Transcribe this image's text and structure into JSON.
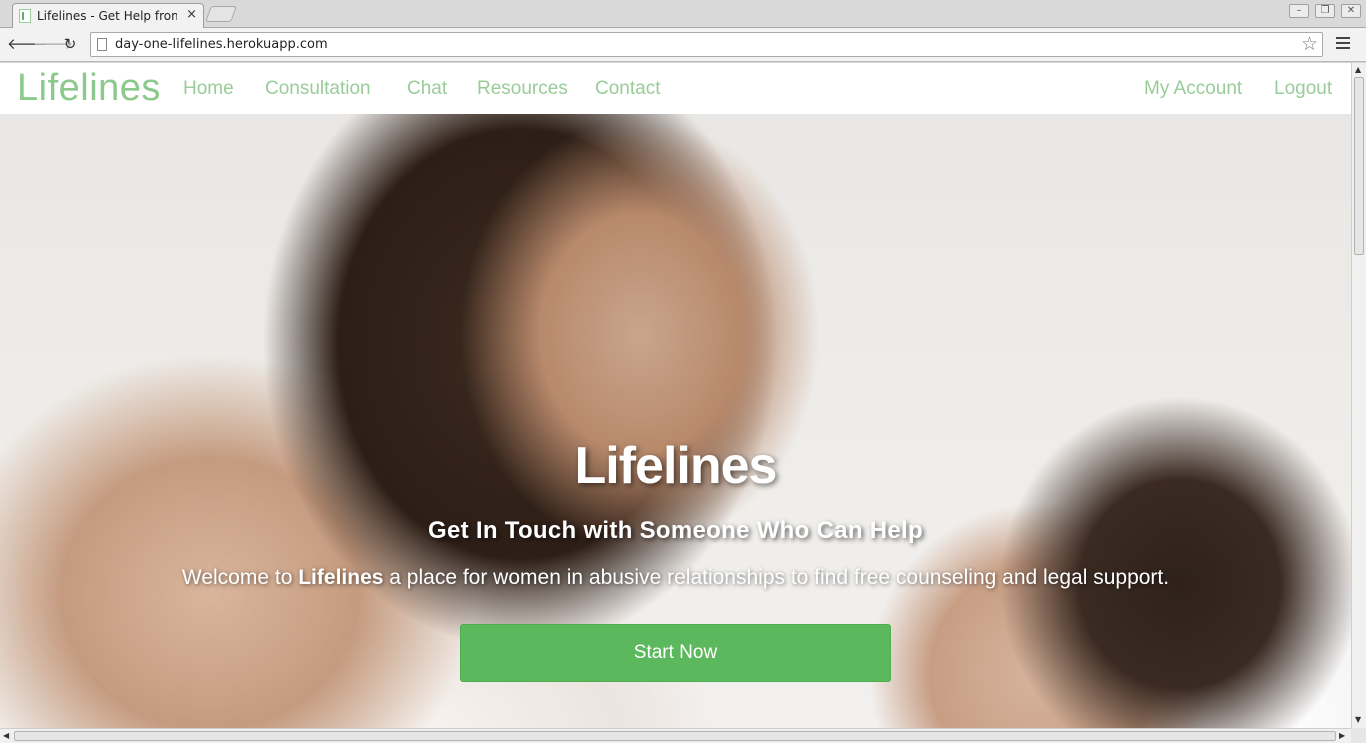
{
  "browser": {
    "tab_title": "Lifelines - Get Help from",
    "tab_close": "×",
    "url": "day-one-lifelines.herokuapp.com",
    "back_glyph": "🡐",
    "forward_glyph": "🡒",
    "reload_glyph": "↻",
    "star_glyph": "☆",
    "icons": [
      "page-icon",
      "star-icon",
      "menu-icon",
      "back-arrow-icon",
      "forward-arrow-icon",
      "reload-icon",
      "minimize-icon",
      "restore-icon",
      "close-icon"
    ]
  },
  "site": {
    "brand": "Lifelines",
    "nav": [
      "Home",
      "Consultation",
      "Chat",
      "Resources",
      "Contact"
    ],
    "account_nav": [
      "My Account",
      "Logout"
    ]
  },
  "hero": {
    "title": "Lifelines",
    "subtitle": "Get In Touch with Someone Who Can Help",
    "welcome_prefix": "Welcome to",
    "welcome_brand": "Lifelines",
    "welcome_suffix": "a place for women in abusive relationships to find free counseling and legal support.",
    "cta": "Start Now"
  },
  "colors": {
    "accent": "#5cb85c",
    "nav_text": "#99cc99"
  }
}
